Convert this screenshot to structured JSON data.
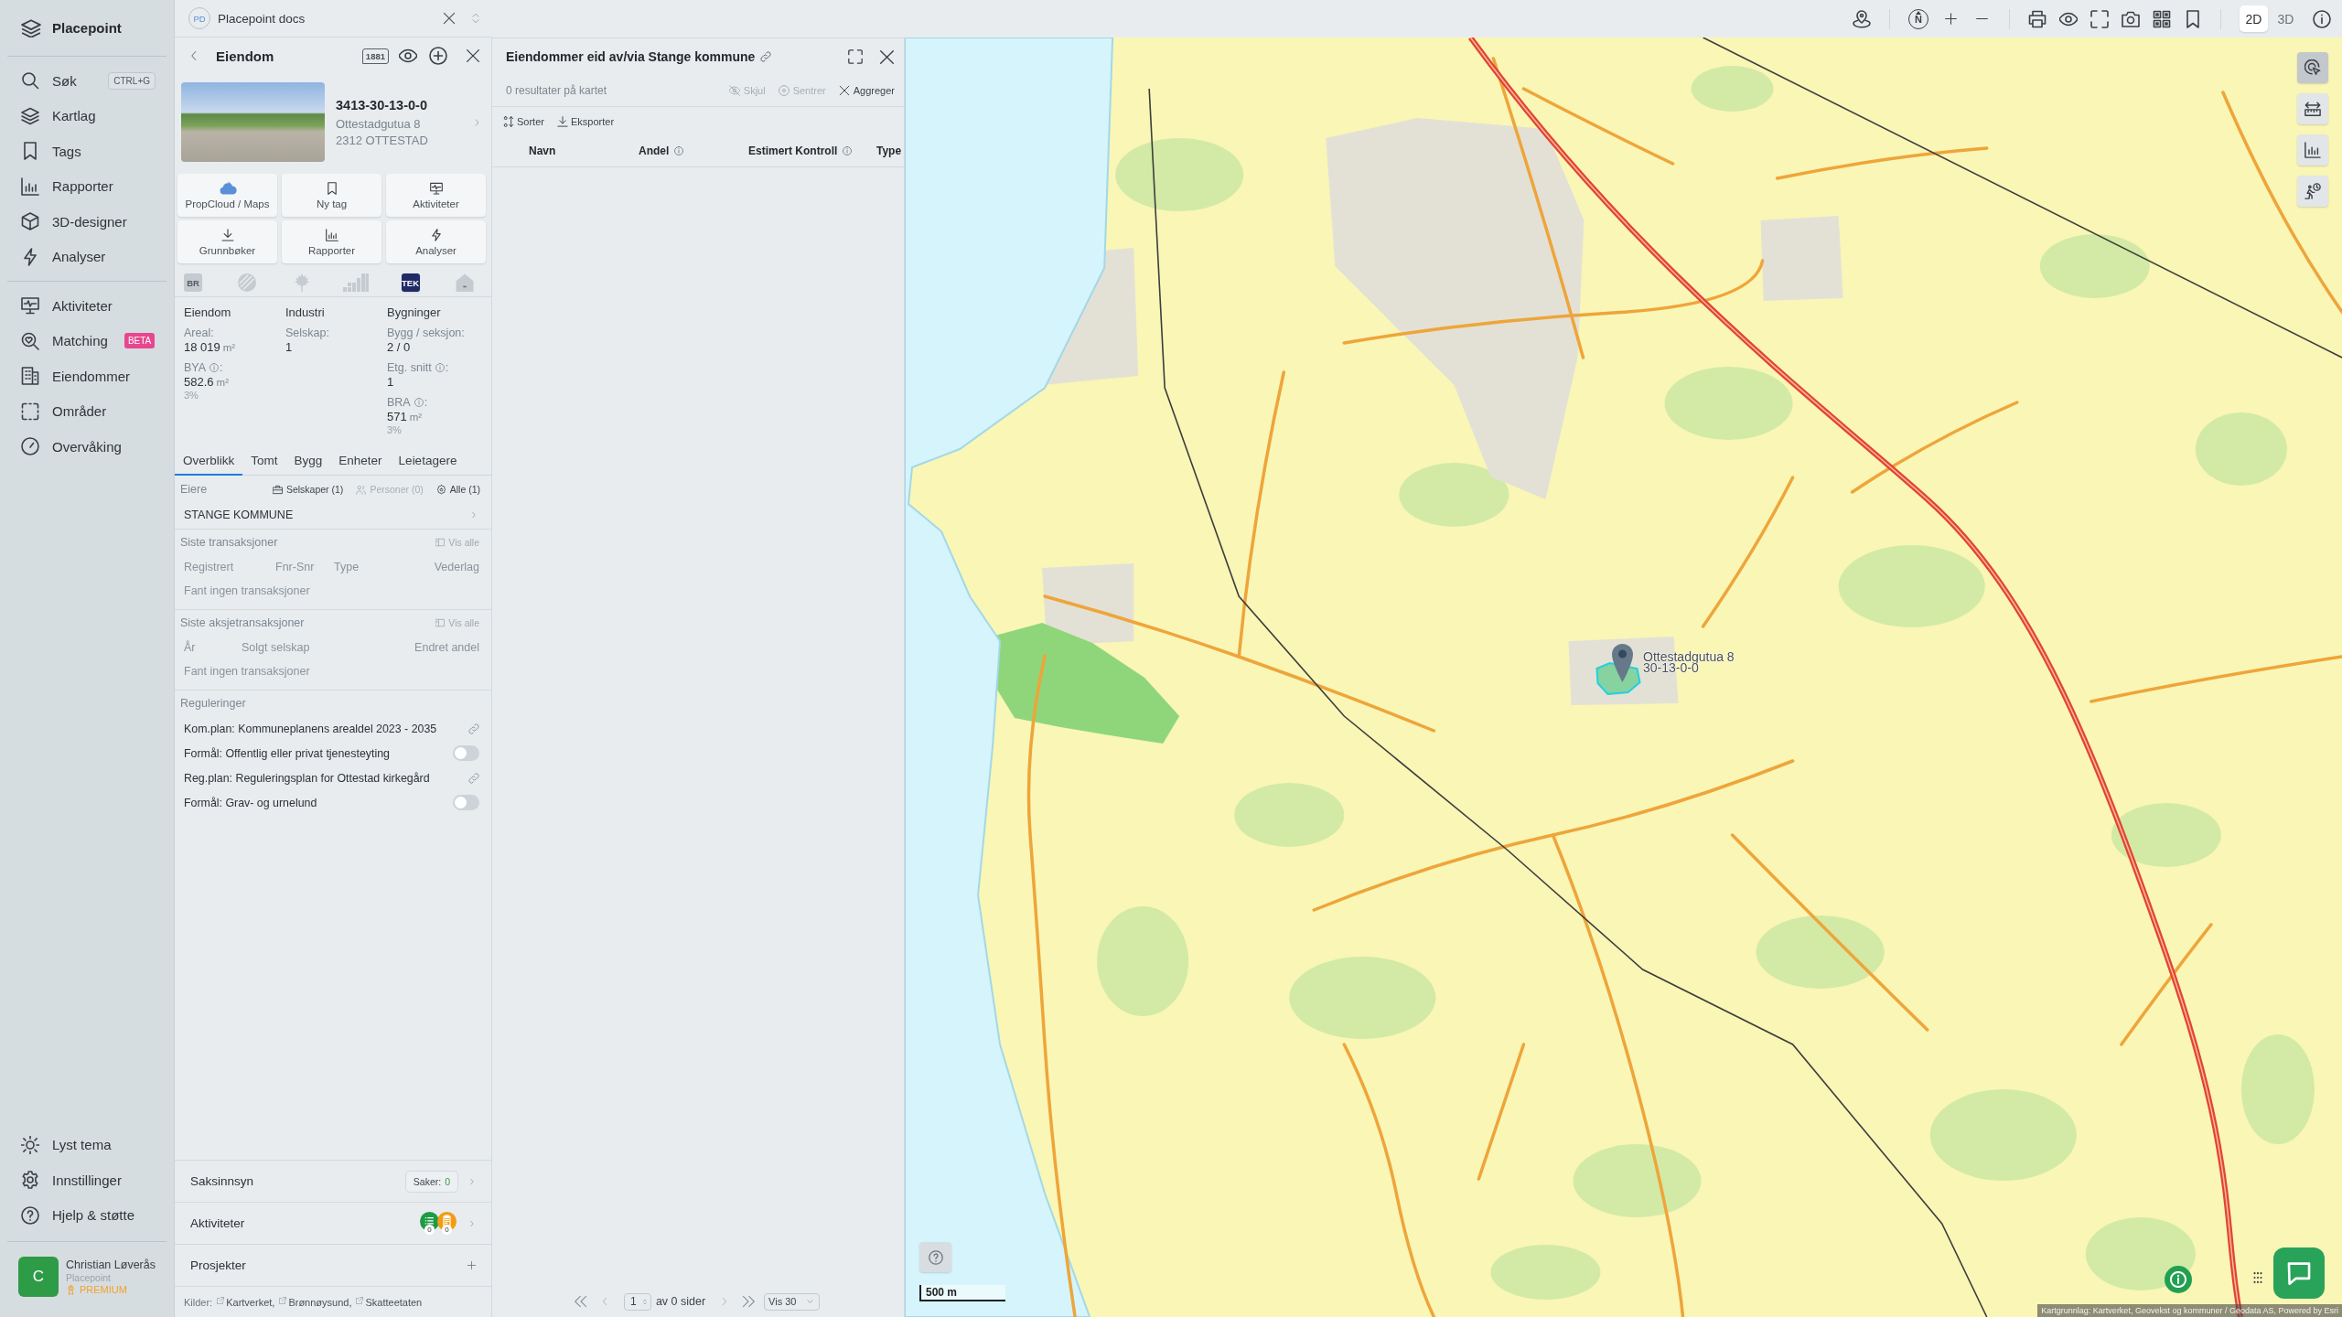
{
  "sidebar": {
    "brand": "Placepoint",
    "groups": [
      [
        {
          "label": "Søk",
          "shortcut": "CTRL+G",
          "selected": false
        },
        {
          "label": "Kartlag",
          "selected": false
        },
        {
          "label": "Tags",
          "selected": false
        },
        {
          "label": "Rapporter",
          "selected": false
        },
        {
          "label": "3D-designer",
          "selected": false
        },
        {
          "label": "Analyser",
          "selected": false
        }
      ],
      [
        {
          "label": "Aktiviteter",
          "selected": false
        },
        {
          "label": "Matching",
          "badge": "BETA",
          "selected": false
        },
        {
          "label": "Eiendommer",
          "selected": false
        },
        {
          "label": "Områder",
          "selected": false
        },
        {
          "label": "Overvåking",
          "selected": false
        }
      ],
      [
        {
          "label": "Lyst tema",
          "selected": false
        },
        {
          "label": "Innstillinger",
          "selected": false
        },
        {
          "label": "Hjelp & støtte",
          "selected": false
        }
      ]
    ],
    "user": {
      "initial": "C",
      "name": "Christian Løverås",
      "organization": "Placepoint",
      "plan": "PREMIUM"
    }
  },
  "workspace": {
    "initials": "PD",
    "name": "Placepoint docs"
  },
  "property_panel": {
    "title": "Eiendom",
    "directory_badge": "1881",
    "property": {
      "id": "3413-30-13-0-0",
      "address": "Ottestadgutua 8",
      "postal": "2312 OTTESTAD"
    },
    "actions": [
      {
        "label": "PropCloud / Maps"
      },
      {
        "label": "Ny tag"
      },
      {
        "label": "Aktiviteter"
      },
      {
        "label": "Grunnbøker"
      },
      {
        "label": "Rapporter"
      },
      {
        "label": "Analyser"
      }
    ],
    "register_badges": [
      {
        "label": "BR",
        "active": false
      },
      {
        "active": false
      },
      {
        "active": false
      },
      {
        "active": false
      },
      {
        "label": "TEK",
        "active": true
      },
      {
        "active": false
      }
    ],
    "stats": [
      {
        "heading": "Eiendom",
        "fields": [
          {
            "label": "Areal:",
            "value": "18 019",
            "unit": "m²"
          },
          {
            "label": "BYA",
            "info": true,
            "label_end": ":",
            "value": "582.6",
            "unit": "m²",
            "share": "3%"
          }
        ]
      },
      {
        "heading": "Industri",
        "fields": [
          {
            "label": "Selskap:",
            "value": "1"
          }
        ]
      },
      {
        "heading": "Bygninger",
        "fields": [
          {
            "label": "Bygg / seksjon:",
            "value": "2 / 0"
          },
          {
            "label": "Etg. snitt",
            "info": true,
            "label_end": ":",
            "value": "1"
          },
          {
            "label": "BRA",
            "info": true,
            "label_end": ":",
            "value": "571",
            "unit": "m²",
            "share": "3%"
          }
        ]
      }
    ],
    "tabs": [
      {
        "label": "Overblikk",
        "selected": true
      },
      {
        "label": "Tomt",
        "selected": false
      },
      {
        "label": "Bygg",
        "selected": false
      },
      {
        "label": "Enheter",
        "selected": false
      },
      {
        "label": "Leietagere",
        "selected": false
      }
    ],
    "owners": {
      "title": "Eiere",
      "filters": [
        {
          "label": "Selskaper (1)",
          "disabled": false
        },
        {
          "label": "Personer (0)",
          "disabled": true
        },
        {
          "label": "Alle (1)",
          "disabled": false
        }
      ],
      "rows": [
        {
          "name": "STANGE KOMMUNE"
        }
      ]
    },
    "tables": [
      {
        "title": "Siste transaksjoner",
        "link": "Vis alle",
        "columns": [
          "Registrert",
          "Fnr-Snr",
          "Type",
          "Vederlag"
        ],
        "empty": "Fant ingen transaksjoner"
      },
      {
        "title": "Siste aksjetransaksjoner",
        "link": "Vis alle",
        "columns": [
          "År",
          "Solgt selskap",
          "Endret andel"
        ],
        "empty": "Fant ingen transaksjoner"
      }
    ],
    "regulations": {
      "title": "Reguleringer",
      "rows": [
        {
          "kind": "link",
          "text": "Kom.plan: Kommuneplanens arealdel 2023 - 2035"
        },
        {
          "kind": "toggle",
          "text": "Formål: Offentlig eller privat tjenesteyting",
          "on": false
        },
        {
          "kind": "link",
          "text": "Reg.plan: Reguleringsplan for Ottestad kirkegård"
        },
        {
          "kind": "toggle",
          "text": "Formål: Grav- og urnelund",
          "on": false
        }
      ]
    },
    "sections": [
      {
        "kind": "count",
        "label": "Saksinnsyn",
        "count_label": "Saker:",
        "count": "0"
      },
      {
        "kind": "activities",
        "label": "Aktiviteter",
        "counters": [
          {
            "color": "#1f9a46",
            "count": "0"
          },
          {
            "color": "#f39c12",
            "count": "0"
          }
        ]
      },
      {
        "kind": "add",
        "label": "Prosjekter"
      }
    ],
    "data_sources": {
      "label": "Kilder:",
      "links": [
        "Kartverket,",
        "Brønnøysund,",
        "Skatteetaten"
      ]
    }
  },
  "ownership_panel": {
    "title": "Eiendommer eid av/via Stange kommune",
    "result_count": "0 resultater på kartet",
    "map_actions": [
      {
        "label": "Skjul",
        "disabled": true
      },
      {
        "label": "Sentrer",
        "disabled": true
      },
      {
        "label": "Aggreger",
        "disabled": false
      }
    ],
    "tools": [
      {
        "label": "Sorter"
      },
      {
        "label": "Eksporter"
      }
    ],
    "columns": [
      {
        "label": "Navn",
        "info": false
      },
      {
        "label": "Andel",
        "info": true
      },
      {
        "label": "Estimert Kontroll",
        "info": true
      },
      {
        "label": "Type",
        "info": false
      }
    ],
    "pagination": {
      "page": "1",
      "total": "av 0 sider",
      "page_size": "Vis 30"
    }
  },
  "map": {
    "compass": "N",
    "view_modes": [
      {
        "label": "2D",
        "selected": true
      },
      {
        "label": "3D",
        "selected": false
      }
    ],
    "side_tools": [
      {
        "selected": true
      },
      {
        "selected": false
      },
      {
        "selected": false
      },
      {
        "selected": false
      }
    ],
    "marker": {
      "lines": [
        "Ottestadgutua 8",
        "30-13-0-0"
      ]
    },
    "scale": "500 m",
    "attribution": "Kartgrunnlag: Kartverket, Geovekst og kommuner / Geodata AS, Powered by Esri"
  }
}
